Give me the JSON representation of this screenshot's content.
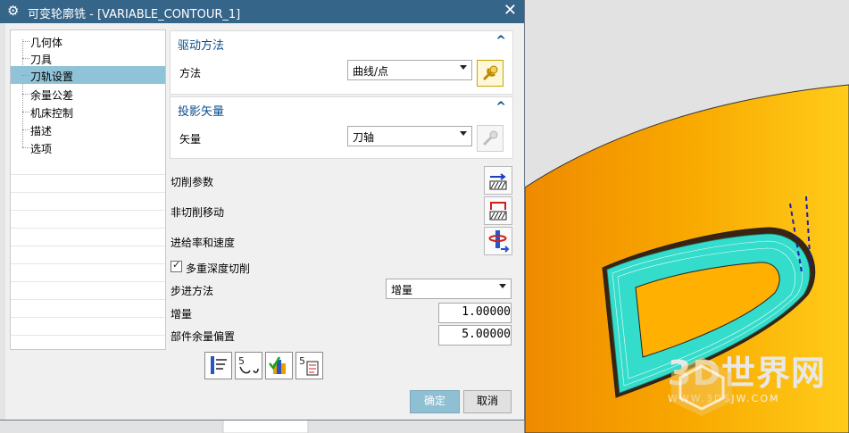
{
  "dialog": {
    "title": "可变轮廓铣 - [VARIABLE_CONTOUR_1]",
    "icons": {
      "title": "gear-icon",
      "close": "close-icon"
    }
  },
  "nav": {
    "items": [
      "几何体",
      "刀具",
      "刀轨设置",
      "余量公差",
      "机床控制",
      "描述",
      "选项"
    ],
    "selected_index": 2
  },
  "drive_method": {
    "title": "驱动方法",
    "method_label": "方法",
    "method_value": "曲线/点"
  },
  "projection": {
    "title": "投影矢量",
    "vector_label": "矢量",
    "vector_value": "刀轴"
  },
  "path_settings": {
    "cut_params_label": "切削参数",
    "non_cut_label": "非切削移动",
    "feeds_label": "进给率和速度",
    "multi_depth_label": "多重深度切削",
    "multi_depth_checked": true,
    "step_method_label": "步进方法",
    "step_method_value": "增量",
    "increment_label": "增量",
    "increment_value": "1.00000",
    "stock_offset_label": "部件余量偏置",
    "stock_offset_value": "5.00000"
  },
  "actions": {
    "ok": "确定",
    "cancel": "取消"
  },
  "watermark": {
    "brand": "3D世界网",
    "url": "WWW.3DSJW.COM"
  },
  "colors": {
    "titlebar": "#36658a",
    "accent_text": "#0d4e8e",
    "selected_row": "#91c3d8",
    "part_orange": "#f7a000",
    "toolpath_cyan": "#33e0d0"
  }
}
